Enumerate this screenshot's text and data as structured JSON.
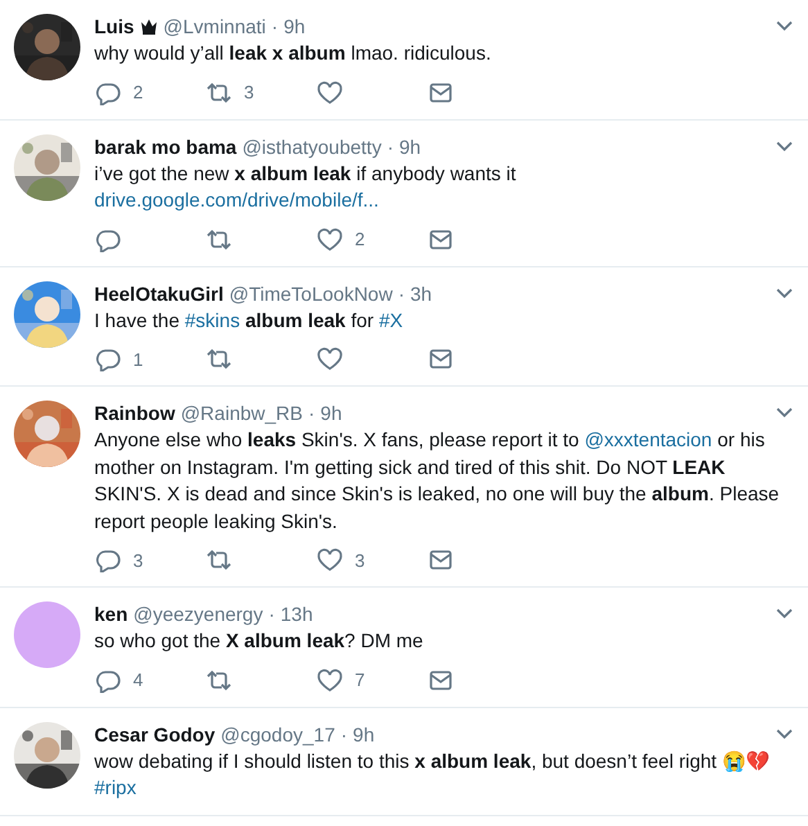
{
  "tweets": [
    {
      "name": "Luis",
      "badge": true,
      "handle": "@Lvminnati",
      "separator": "·",
      "time": "9h",
      "avatar": {
        "kind": "picture"
      },
      "text": [
        {
          "kind": "plain",
          "text": "why would y’all **leak x album** lmao. ridiculous."
        }
      ],
      "actions": {
        "replies": "2",
        "retweets": "3"
      }
    },
    {
      "name": "barak mo bama",
      "handle": "@isthatyoubetty",
      "separator": "·",
      "time": "9h",
      "avatar": {
        "kind": "picture"
      },
      "text": [
        {
          "kind": "plain",
          "text": "i’ve got the new **x album leak** if anybody wants it"
        },
        {
          "kind": "break"
        },
        {
          "kind": "link",
          "text": "drive.google.com/drive/mobile/f..."
        }
      ],
      "actions": {
        "likes": "2"
      }
    },
    {
      "name": "HeelOtakuGirl",
      "handle": "@TimeToLookNow",
      "separator": "·",
      "time": "3h",
      "avatar": {
        "kind": "picture"
      },
      "text": [
        {
          "kind": "plain",
          "text": "I have the "
        },
        {
          "kind": "link",
          "text": "#skins"
        },
        {
          "kind": "plain",
          "text": " **album leak** for "
        },
        {
          "kind": "link",
          "text": "#X"
        }
      ],
      "actions": {
        "replies": "1"
      }
    },
    {
      "name": "Rainbow",
      "handle": "@Rainbw_RB",
      "separator": "·",
      "time": "9h",
      "avatar": {
        "kind": "picture"
      },
      "text": [
        {
          "kind": "plain",
          "text": "Anyone else who **leaks** Skin's. X fans, please report it to "
        },
        {
          "kind": "link",
          "text": "@xxxtentacion"
        },
        {
          "kind": "plain",
          "text": " or his mother on Instagram. I'm getting sick and tired of this shit. Do NOT **LEAK** SKIN'S. X is dead and since Skin's is leaked, no one will buy the **album**. Please report people leaking Skin's."
        }
      ],
      "actions": {
        "replies": "3",
        "likes": "3"
      }
    },
    {
      "name": "ken",
      "handle": "@yeezyenergy",
      "separator": "·",
      "time": "13h",
      "avatar": {
        "kind": "plain",
        "color": "#d6aaf7"
      },
      "text": [
        {
          "kind": "plain",
          "text": "so who got the **X album leak**? DM me"
        }
      ],
      "actions": {
        "replies": "4",
        "likes": "7"
      }
    },
    {
      "name": "Cesar Godoy",
      "handle": "@cgodoy_17",
      "separator": "·",
      "time": "9h",
      "avatar": {
        "kind": "picture"
      },
      "text": [
        {
          "kind": "plain",
          "text": "wow debating if I should listen to this **x album leak**, but doesn’t feel right 😭💔"
        },
        {
          "kind": "break"
        },
        {
          "kind": "link",
          "text": "#ripx"
        }
      ]
    }
  ]
}
